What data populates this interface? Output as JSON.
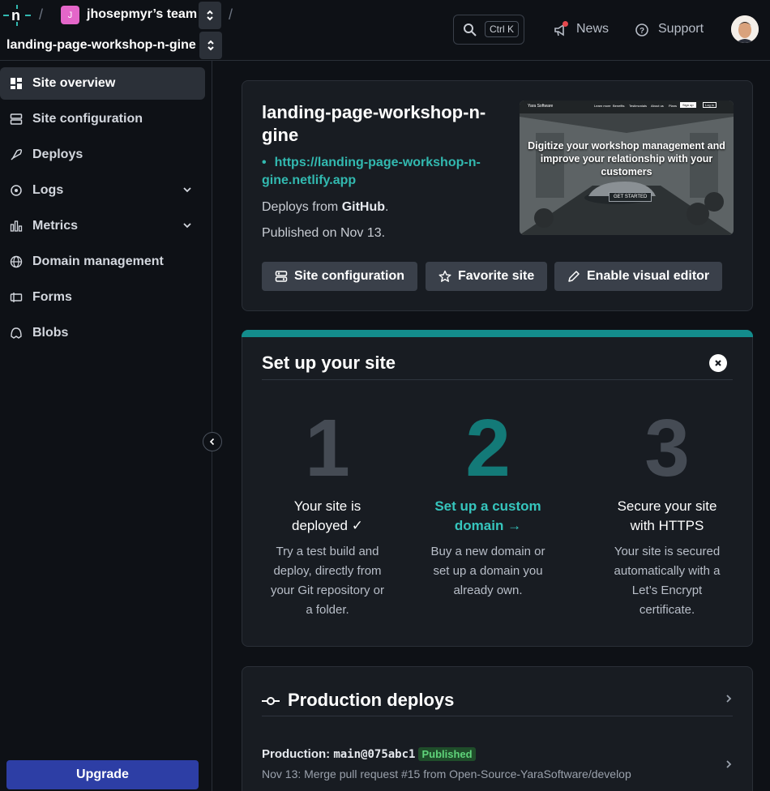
{
  "topbar": {
    "team_initial": "J",
    "team_name": "jhosepmyr’s team",
    "site_name": "landing-page-workshop-n-gine",
    "search_kbd": "Ctrl K",
    "news_label": "News",
    "support_label": "Support"
  },
  "sidebar": {
    "items": [
      {
        "label": "Site overview",
        "icon": "grid-icon"
      },
      {
        "label": "Site configuration",
        "icon": "sliders-icon"
      },
      {
        "label": "Deploys",
        "icon": "rocket-icon"
      },
      {
        "label": "Logs",
        "icon": "logs-icon"
      },
      {
        "label": "Metrics",
        "icon": "bar-chart-icon"
      },
      {
        "label": "Domain management",
        "icon": "globe-icon"
      },
      {
        "label": "Forms",
        "icon": "form-icon"
      },
      {
        "label": "Blobs",
        "icon": "blob-icon"
      }
    ],
    "upgrade_label": "Upgrade"
  },
  "overview": {
    "title": "landing-page-workshop-n-gine",
    "url": "https://landing-page-workshop-n-gine.netlify.app",
    "deploys_from_prefix": "Deploys from ",
    "deploys_from_source": "GitHub",
    "deploys_from_suffix": ".",
    "published": "Published on Nov 13.",
    "preview": {
      "brand": "Yara Software",
      "nav_links": [
        "Learn more",
        "Benefits",
        "Testimonials",
        "About us",
        "Plans"
      ],
      "signup": "Sign up",
      "login": "Log in",
      "hero": "Digitize your workshop management and improve your relationship with your customers",
      "cta": "GET STARTED"
    },
    "buttons": {
      "site_config": "Site configuration",
      "favorite": "Favorite site",
      "visual_editor": "Enable visual editor"
    }
  },
  "setup": {
    "title": "Set up your site",
    "steps": [
      {
        "num": "1",
        "title": "Your site is deployed ✓",
        "desc": "Try a test build and deploy, directly from your Git repository or a folder."
      },
      {
        "num": "2",
        "title": "Set up a custom domain →",
        "desc": "Buy a new domain or set up a domain you already own."
      },
      {
        "num": "3",
        "title": "Secure your site with HTTPS",
        "desc": "Your site is secured automatically with a Let’s Encrypt certificate."
      }
    ]
  },
  "production": {
    "title": "Production deploys",
    "label": "Production: ",
    "ref": "main@075abc1",
    "badge": "Published",
    "message": "Nov 13: Merge pull request #15 from Open-Source-YaraSoftware/develop"
  },
  "colors": {
    "accent_teal": "#138c8c",
    "link_teal": "#32b9b0",
    "upgrade_blue": "#2d3ea5",
    "news_dot": "#e5484d"
  }
}
